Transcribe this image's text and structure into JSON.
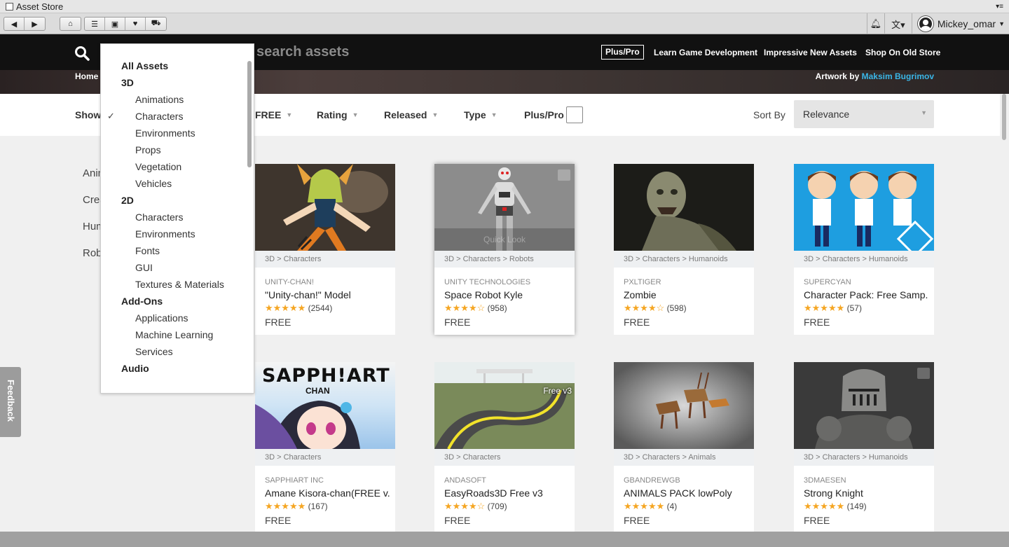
{
  "window": {
    "title": "Asset Store"
  },
  "toolbar": {
    "user": "Mickey_omar"
  },
  "header": {
    "search_placeholder": "search assets",
    "plus_pro": "Plus/Pro",
    "links": [
      "Learn Game Development",
      "Impressive New Assets",
      "Shop On Old Store"
    ],
    "breadcrumb_home": "Home",
    "artwork_label": "Artwork by",
    "artwork_artist": "Maksim Bugrimov"
  },
  "filters": {
    "showing": "Showi",
    "items": [
      "FREE",
      "Rating",
      "Released",
      "Type"
    ],
    "plus_pro": "Plus/Pro",
    "sort_label": "Sort By",
    "sort_value": "Relevance"
  },
  "sidebar_categories": [
    "Anim",
    "Crea",
    "Hum",
    "Rob"
  ],
  "dropdown": {
    "items": [
      {
        "label": "All Assets",
        "level": "top"
      },
      {
        "label": "3D",
        "level": "top"
      },
      {
        "label": "Animations",
        "level": "sub"
      },
      {
        "label": "Characters",
        "level": "sub",
        "checked": true
      },
      {
        "label": "Environments",
        "level": "sub"
      },
      {
        "label": "Props",
        "level": "sub"
      },
      {
        "label": "Vegetation",
        "level": "sub"
      },
      {
        "label": "Vehicles",
        "level": "sub"
      },
      {
        "label": "2D",
        "level": "top"
      },
      {
        "label": "Characters",
        "level": "sub"
      },
      {
        "label": "Environments",
        "level": "sub"
      },
      {
        "label": "Fonts",
        "level": "sub"
      },
      {
        "label": "GUI",
        "level": "sub"
      },
      {
        "label": "Textures & Materials",
        "level": "sub"
      },
      {
        "label": "Add-Ons",
        "level": "top"
      },
      {
        "label": "Applications",
        "level": "sub"
      },
      {
        "label": "Machine Learning",
        "level": "sub"
      },
      {
        "label": "Services",
        "level": "sub"
      },
      {
        "label": "Audio",
        "level": "top"
      }
    ]
  },
  "assets": [
    {
      "category": "3D > Characters",
      "publisher": "UNITY-CHAN!",
      "name": "\"Unity-chan!\" Model",
      "stars": "★★★★★",
      "reviews": "(2544)",
      "price": "FREE"
    },
    {
      "category": "3D > Characters > Robots",
      "publisher": "UNITY TECHNOLOGIES",
      "name": "Space Robot Kyle",
      "stars": "★★★★☆",
      "reviews": "(958)",
      "price": "FREE",
      "overlay": "Quick Look"
    },
    {
      "category": "3D > Characters > Humanoids",
      "publisher": "PXLTIGER",
      "name": "Zombie",
      "stars": "★★★★☆",
      "reviews": "(598)",
      "price": "FREE"
    },
    {
      "category": "3D > Characters > Humanoids",
      "publisher": "SUPERCYAN",
      "name": "Character Pack: Free Samp.",
      "stars": "★★★★★",
      "reviews": "(57)",
      "price": "FREE"
    },
    {
      "category": "3D > Characters",
      "publisher": "SAPPHIART INC",
      "name": "Amane Kisora-chan(FREE v.",
      "stars": "★★★★★",
      "reviews": "(167)",
      "price": "FREE",
      "thumb_text": "SAPPH!ART",
      "thumb_sub": "CHAN"
    },
    {
      "category": "3D > Characters",
      "publisher": "ANDASOFT",
      "name": "EasyRoads3D Free v3",
      "stars": "★★★★☆",
      "reviews": "(709)",
      "price": "FREE",
      "thumb_badge": "Free v3"
    },
    {
      "category": "3D > Characters > Animals",
      "publisher": "GBANDREWGB",
      "name": "ANIMALS PACK lowPoly",
      "stars": "★★★★★",
      "reviews": "(4)",
      "price": "FREE"
    },
    {
      "category": "3D > Characters > Humanoids",
      "publisher": "3DMAESEN",
      "name": "Strong Knight",
      "stars": "★★★★★",
      "reviews": "(149)",
      "price": "FREE"
    }
  ],
  "feedback": "Feedback",
  "colors": {
    "accent": "#3ab5e6",
    "star": "#f5a623",
    "header": "#111111"
  }
}
